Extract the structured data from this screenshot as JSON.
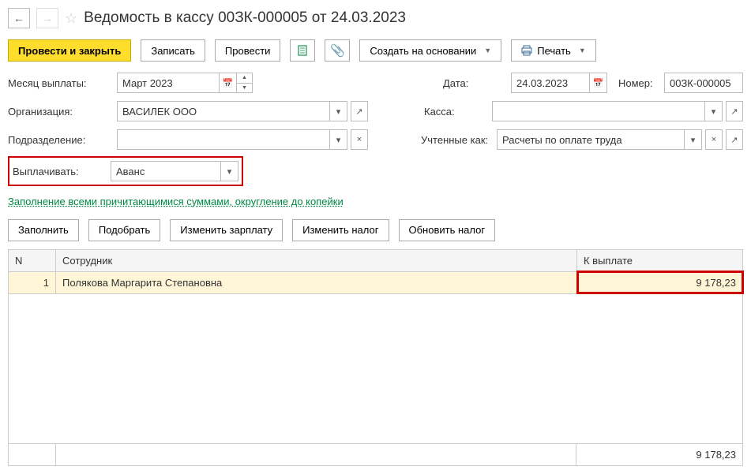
{
  "title": "Ведомость в кассу 00ЗК-000005 от 24.03.2023",
  "toolbar": {
    "post_close": "Провести и закрыть",
    "save": "Записать",
    "post": "Провести",
    "create_based": "Создать на основании",
    "print": "Печать"
  },
  "form": {
    "month_label": "Месяц выплаты:",
    "month_value": "Март 2023",
    "date_label": "Дата:",
    "date_value": "24.03.2023",
    "number_label": "Номер:",
    "number_value": "00ЗК-000005",
    "org_label": "Организация:",
    "org_value": "ВАСИЛЕК ООО",
    "kassa_label": "Касса:",
    "kassa_value": "",
    "dept_label": "Подразделение:",
    "dept_value": "",
    "accounted_label": "Учтенные как:",
    "accounted_value": "Расчеты по оплате труда",
    "pay_label": "Выплачивать:",
    "pay_value": "Аванс"
  },
  "link_text": "Заполнение всеми причитающимися суммами, округление до копейки",
  "actions": {
    "fill": "Заполнить",
    "pick": "Подобрать",
    "change_salary": "Изменить зарплату",
    "change_tax": "Изменить налог",
    "update_tax": "Обновить налог"
  },
  "grid": {
    "col_n": "N",
    "col_emp": "Сотрудник",
    "col_pay": "К выплате",
    "rows": [
      {
        "n": "1",
        "emp": "Полякова Маргарита Степановна",
        "pay": "9 178,23"
      }
    ],
    "total_pay": "9 178,23"
  }
}
